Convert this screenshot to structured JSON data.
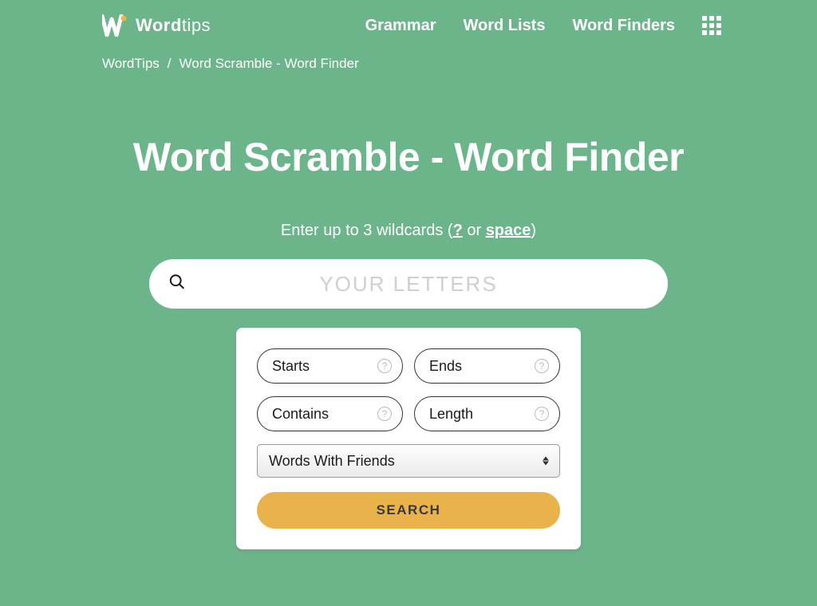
{
  "brand": {
    "word1": "Word",
    "word2": "tips"
  },
  "nav": {
    "grammar": "Grammar",
    "word_lists": "Word Lists",
    "word_finders": "Word Finders"
  },
  "breadcrumb": {
    "home": "WordTips",
    "separator": "/",
    "current": "Word Scramble - Word Finder"
  },
  "hero": {
    "title": "Word Scramble - Word Finder",
    "subtitle_pre": "Enter up to 3 wildcards (",
    "subtitle_q": "?",
    "subtitle_mid": " or ",
    "subtitle_space": "space",
    "subtitle_post": ")"
  },
  "search": {
    "placeholder": "YOUR LETTERS",
    "value": ""
  },
  "filters": {
    "starts": {
      "placeholder": "Starts",
      "value": ""
    },
    "ends": {
      "placeholder": "Ends",
      "value": ""
    },
    "contains": {
      "placeholder": "Contains",
      "value": ""
    },
    "length": {
      "placeholder": "Length",
      "value": ""
    },
    "help_glyph": "?",
    "dictionary_selected": "Words With Friends",
    "search_button": "SEARCH"
  }
}
